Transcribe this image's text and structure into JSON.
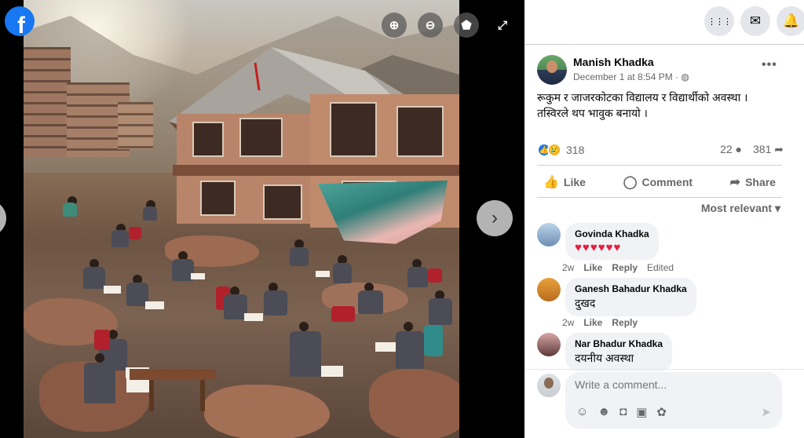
{
  "viewer": {
    "brand_icon": "facebook-logo-icon",
    "controls": [
      {
        "name": "zoom-in-icon",
        "glyph": "⊕"
      },
      {
        "name": "zoom-out-icon",
        "glyph": "⊖"
      },
      {
        "name": "tag-icon",
        "glyph": "⬟"
      },
      {
        "name": "fullscreen-icon",
        "glyph": "⤢"
      }
    ],
    "next_glyph": "›"
  },
  "topbar": {
    "menu_glyph": "⋮⋮⋮",
    "messenger_glyph": "✉",
    "notifications_glyph": "🔔"
  },
  "post": {
    "author": "Manish Khadka",
    "meta": "December 1 at 8:54 PM · ◍",
    "text_line1": "रूकुम र जाजरकोटका विद्यालय र विद्यार्थीको अवस्था ।",
    "text_line2": "तस्विरले थप भावुक बनायो ।",
    "reaction_count": "318",
    "comments_count": "22",
    "shares_count": "381",
    "more_glyph": "•••"
  },
  "actions": {
    "like": "Like",
    "comment": "Comment",
    "share": "Share"
  },
  "sort": "Most relevant ▾",
  "comments": [
    {
      "name": "Govinda Khadka",
      "text": "♥♥♥♥♥♥",
      "time": "2w",
      "like": "Like",
      "reply": "Reply",
      "edited": "Edited"
    },
    {
      "name": "Ganesh Bahadur Khadka",
      "text": "दुखद",
      "time": "2w",
      "like": "Like",
      "reply": "Reply"
    },
    {
      "name": "Nar Bhadur Khadka",
      "text": "दयनीय अवस्था"
    }
  ],
  "composer": {
    "placeholder": "Write a comment...",
    "send_glyph": "➤"
  },
  "colors": {
    "brand": "#1877f2",
    "heart": "#e41e3f",
    "muted": "#65676b",
    "bubble": "#f0f2f5"
  }
}
